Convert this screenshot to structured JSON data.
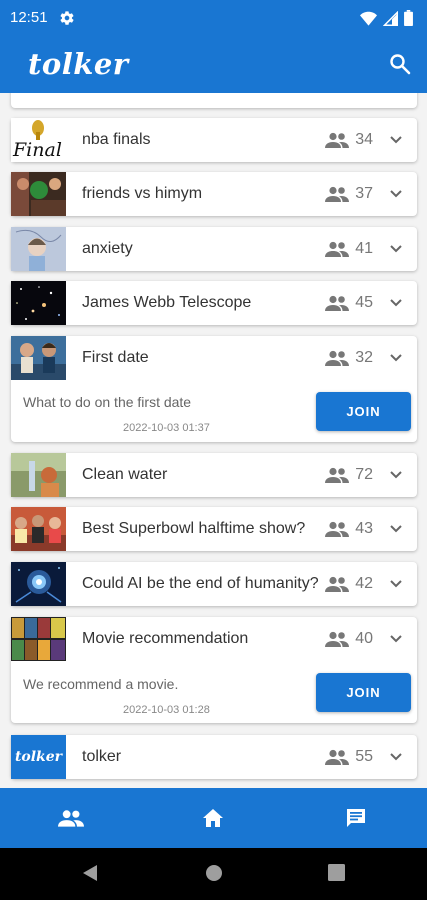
{
  "status_bar": {
    "time": "12:51"
  },
  "app_bar": {
    "title": "tolker"
  },
  "colors": {
    "primary": "#1976d2",
    "background": "#f3f3f3",
    "icon_gray": "#777777"
  },
  "rooms": [
    {
      "title": "",
      "members": "",
      "thumb": "space-image"
    },
    {
      "title": "nba finals",
      "members": "34",
      "thumb": "final-text-image"
    },
    {
      "title": "friends vs himym",
      "members": "37",
      "thumb": "tv-show-image"
    },
    {
      "title": "anxiety",
      "members": "41",
      "thumb": "drawing-image"
    },
    {
      "title": "James Webb Telescope",
      "members": "45",
      "thumb": "galaxy-image"
    },
    {
      "title": "First date",
      "members": "32",
      "thumb": "couple-image",
      "expanded": true,
      "description": "What to do on the first date",
      "date": "2022-10-03 01:37",
      "join_label": "JOIN"
    },
    {
      "title": "Clean water",
      "members": "72",
      "thumb": "water-image"
    },
    {
      "title": "Best Superbowl halftime show?",
      "members": "43",
      "thumb": "stage-image"
    },
    {
      "title": "Could AI be the end of humanity?",
      "members": "42",
      "thumb": "robot-image"
    },
    {
      "title": "Movie recommendation",
      "members": "40",
      "thumb": "movie-posters-image",
      "expanded": true,
      "description": "We recommend a movie.",
      "date": "2022-10-03 01:28",
      "join_label": "JOIN"
    },
    {
      "title": "tolker",
      "members": "55",
      "thumb": "tolker-logo-image",
      "thumb_text": "tolker"
    }
  ],
  "bottom_nav": [
    {
      "icon": "people-icon"
    },
    {
      "icon": "home-icon"
    },
    {
      "icon": "chat-icon"
    }
  ],
  "system_nav": [
    {
      "icon": "back-icon"
    },
    {
      "icon": "home-circle-icon"
    },
    {
      "icon": "recents-icon"
    }
  ]
}
